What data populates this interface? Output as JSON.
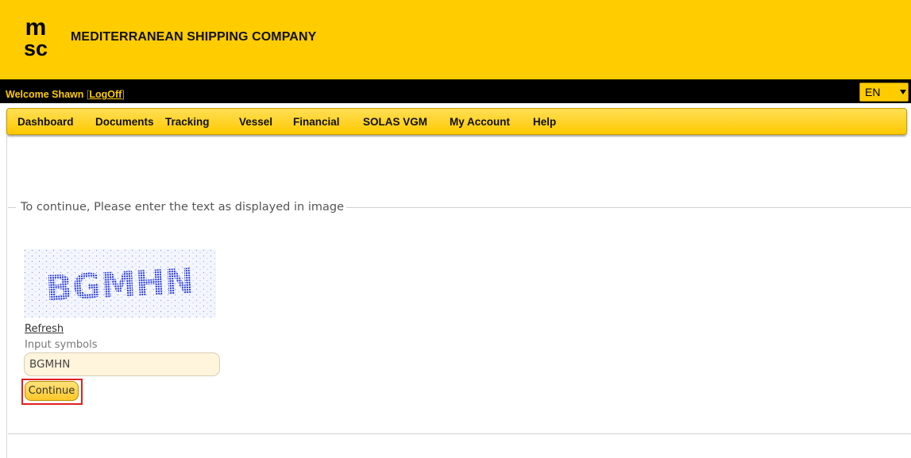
{
  "header": {
    "logo_text": "msc",
    "company_name": "MEDITERRANEAN SHIPPING COMPANY",
    "brand_color": "#ffcc00"
  },
  "topbar": {
    "welcome_text": "Welcome Shawn",
    "sep_open": "[",
    "logoff_label": "LogOff",
    "sep_close": "]",
    "language": "EN"
  },
  "nav": {
    "items": [
      "Dashboard",
      "Documents",
      "Tracking",
      "Vessel",
      "Financial",
      "SOLAS VGM",
      "My Account",
      "Help"
    ]
  },
  "main": {
    "legend": "To continue, Please enter the text as displayed in image",
    "captcha_text": "BGMHN",
    "refresh_label": "Refresh",
    "input_label": "Input symbols",
    "input_value": "BGMHN",
    "continue_label": "Continue"
  },
  "colors": {
    "highlight": "#e02020",
    "captcha_dots": "#1a2fd6"
  },
  "icons": {
    "language_caret": "chevron-down-icon"
  }
}
